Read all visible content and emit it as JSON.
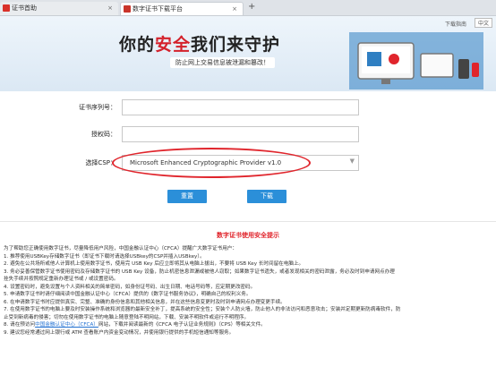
{
  "tabs": [
    {
      "title": "证书首助",
      "close": "×"
    },
    {
      "title": "数字证书下载平台",
      "close": "×"
    }
  ],
  "new_tab": "+",
  "banner": {
    "title_before": "你的",
    "title_accent": "安全",
    "title_after": "我们来守护",
    "subtitle": "防止网上交易信息被泄漏和篡改！",
    "help": "下载指南",
    "lang": "中文"
  },
  "form": {
    "serial_label": "证书序列号：",
    "serial_value": "",
    "auth_label": "授权码：",
    "auth_value": "",
    "csp_label": "选择CSP：",
    "csp_value": "Microsoft Enhanced Cryptographic Provider v1.0"
  },
  "buttons": {
    "reset": "重置",
    "download": "下载"
  },
  "notice": {
    "title": "数字证书使用安全提示",
    "lines": [
      "为了帮助您正确使用数字证书，尽量降低用户风险，中国金融认证中心（CFCA）提醒广大数字证书用户：",
      "1. 推荐使用USBKey存储数字证书（即证书下载时请选择USBkey的CSP并插入USBkey）。",
      "2. 避免在公共场所或他人计算机上使用数字证书，使用完 USB Key 后应立即将其从电脑上拔出，不要将 USB Key 长时间留在电脑上。",
      "3. 务必妥善保管数字证书使用密码及存储数字证书的 USB Key 设备，防止机密信息泄漏或被他人窃取；如果数字证书遗失，或者发现相关的密码泄露，务必及时到申请网点办理",
      "挂失手续并按照规定重新办理证书或 / 或设置密码。",
      "4. 设置密码时，避免设置与个人资料相关的简单密码，如身份证号码、出生日期、电话号码等，应定期更改密码。",
      "5. 申请数字证书时请仔细阅读中国金融认证中心（CFCA）提供的《数字证书服务协议》，明确自己的权利义务。",
      "6. 在申请数字证书时应提供真实、完整、准确的身份信息和其他相关信息，并在这些信息变更时及时到申请网点办理变更手续。",
      "7. 在使用数字证书的电脑上要及时安装操作系统和浏览器的最新安全补丁，提高系统的安全性；安装个人防火墙，防止他人的非法访问和恶意攻击；安装并定期更新防病毒软件，防",
      "止受到新病毒的侵害；切勿在使用数字证书的电脑上随意登陆不明网站，下载、安装不明软件或运行不明程序。"
    ],
    "line8_before": "8. 请在预访问",
    "line8_link": "中国金融认证中心（CFCA）",
    "line8_after": "网站，下载并阅读最新的《CFCA 电子认证业务规则》（CPS）等相关文件。",
    "line9": "9. 建议您经常通过网上银行或 ATM 查看账户内资金变动情况，并使用银行提供的手机短信通知等服务。"
  }
}
